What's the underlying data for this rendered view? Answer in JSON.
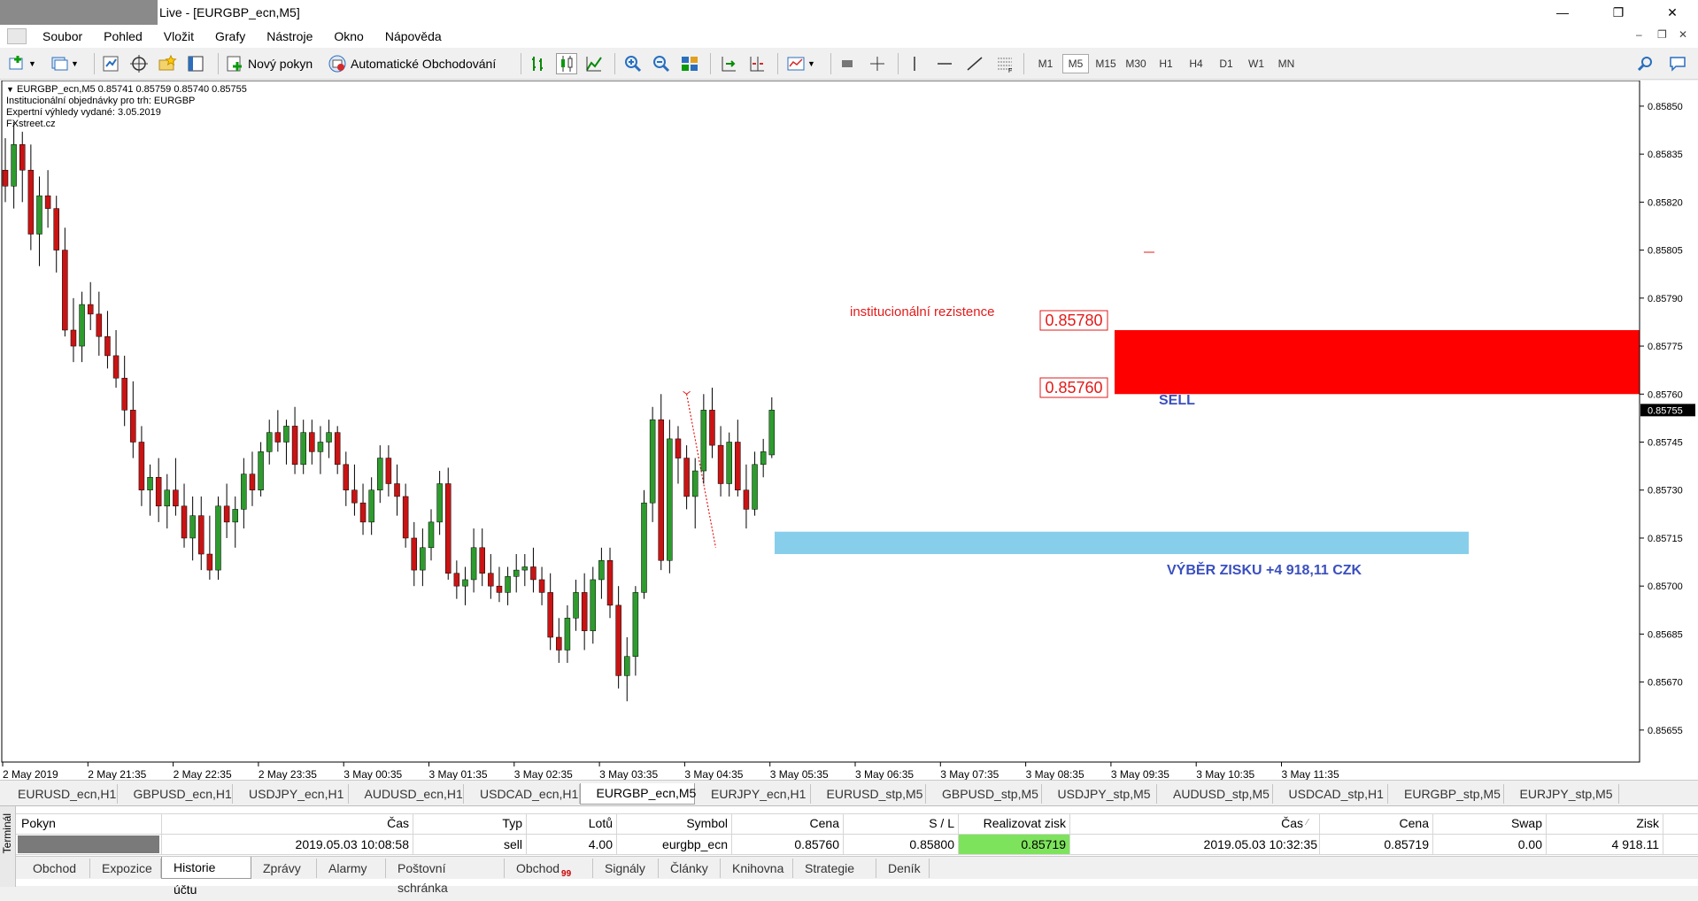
{
  "window": {
    "title": "Live - [EURGBP_ecn,M5]",
    "minimize": "—",
    "maximize": "❐",
    "close": "✕"
  },
  "menu": {
    "items": [
      "Soubor",
      "Pohled",
      "Vložit",
      "Grafy",
      "Nástroje",
      "Okno",
      "Nápověda"
    ],
    "mdi": [
      "–",
      "❐",
      "✕"
    ]
  },
  "toolbar": {
    "new_order": "Nový pokyn",
    "auto_trading": "Automatické Obchodování",
    "timeframes": [
      "M1",
      "M5",
      "M15",
      "M30",
      "H1",
      "H4",
      "D1",
      "W1",
      "MN"
    ],
    "active_timeframe": "M5"
  },
  "chart": {
    "info_lines": [
      "EURGBP_ecn,M5  0.85741 0.85759 0.85740 0.85755",
      "Institucionální objednávky pro trh: EURGBP",
      "Expertní výhledy vydané: 3.05.2019",
      "FXstreet.cz"
    ],
    "current_price": "0.85755",
    "price_ticks": [
      "0.85850",
      "0.85835",
      "0.85820",
      "0.85805",
      "0.85790",
      "0.85775",
      "0.85760",
      "0.85745",
      "0.85730",
      "0.85715",
      "0.85700",
      "0.85685",
      "0.85670",
      "0.85655"
    ],
    "time_ticks": [
      "2 May 2019",
      "2 May 21:35",
      "2 May 22:35",
      "2 May 23:35",
      "3 May 00:35",
      "3 May 01:35",
      "3 May 02:35",
      "3 May 03:35",
      "3 May 04:35",
      "3 May 05:35",
      "3 May 06:35",
      "3 May 07:35",
      "3 May 08:35",
      "3 May 09:35",
      "3 May 10:35",
      "3 May 11:35"
    ],
    "resistance_label": "institucionální rezistence",
    "resistance_upper": "0.85780",
    "resistance_lower": "0.85760",
    "sell_label": "SELL",
    "profit_label": "VÝBĚR ZISKU +4 918,11 CZK",
    "colors": {
      "bull": "#2e9b2e",
      "bear": "#c81414",
      "resistance_zone": "#ff0000",
      "target_zone": "#87ceeb",
      "annotation": "#3a4fbf",
      "label_red": "#e31b1b"
    },
    "chart_data": {
      "type": "candlestick",
      "symbol": "EURGBP_ecn",
      "timeframe": "M5",
      "last": {
        "open": 0.85741,
        "high": 0.85759,
        "low": 0.8574,
        "close": 0.85755
      },
      "ylim": [
        0.85645,
        0.85858
      ],
      "resistance_zone": [
        0.8576,
        0.8578
      ],
      "target_zone": [
        0.8571,
        0.85717
      ],
      "candles": [
        [
          0.8583,
          0.8584,
          0.8582,
          0.85825
        ],
        [
          0.85825,
          0.85845,
          0.85818,
          0.85838
        ],
        [
          0.85838,
          0.85842,
          0.8582,
          0.8583
        ],
        [
          0.8583,
          0.85838,
          0.85805,
          0.8581
        ],
        [
          0.8581,
          0.85828,
          0.858,
          0.85822
        ],
        [
          0.85822,
          0.8583,
          0.85812,
          0.85818
        ],
        [
          0.85818,
          0.85822,
          0.85798,
          0.85805
        ],
        [
          0.85805,
          0.85812,
          0.85778,
          0.8578
        ],
        [
          0.8578,
          0.8579,
          0.8577,
          0.85775
        ],
        [
          0.85775,
          0.85792,
          0.8577,
          0.85788
        ],
        [
          0.85788,
          0.85795,
          0.8578,
          0.85785
        ],
        [
          0.85785,
          0.85792,
          0.85772,
          0.85778
        ],
        [
          0.85778,
          0.85786,
          0.85768,
          0.85772
        ],
        [
          0.85772,
          0.8578,
          0.85762,
          0.85765
        ],
        [
          0.85765,
          0.85772,
          0.8575,
          0.85755
        ],
        [
          0.85755,
          0.85764,
          0.8574,
          0.85745
        ],
        [
          0.85745,
          0.8575,
          0.85725,
          0.8573
        ],
        [
          0.8573,
          0.85738,
          0.85722,
          0.85734
        ],
        [
          0.85734,
          0.8574,
          0.8572,
          0.85725
        ],
        [
          0.85725,
          0.85735,
          0.85718,
          0.8573
        ],
        [
          0.8573,
          0.8574,
          0.85722,
          0.85725
        ],
        [
          0.85725,
          0.85732,
          0.85712,
          0.85715
        ],
        [
          0.85715,
          0.85728,
          0.85708,
          0.85722
        ],
        [
          0.85722,
          0.85728,
          0.85705,
          0.8571
        ],
        [
          0.8571,
          0.85722,
          0.85702,
          0.85705
        ],
        [
          0.85705,
          0.85728,
          0.85702,
          0.85725
        ],
        [
          0.85725,
          0.85732,
          0.85715,
          0.8572
        ],
        [
          0.8572,
          0.85728,
          0.85712,
          0.85724
        ],
        [
          0.85724,
          0.8574,
          0.85718,
          0.85735
        ],
        [
          0.85735,
          0.85742,
          0.85725,
          0.8573
        ],
        [
          0.8573,
          0.85745,
          0.85728,
          0.85742
        ],
        [
          0.85742,
          0.85752,
          0.85738,
          0.85748
        ],
        [
          0.85748,
          0.85755,
          0.85742,
          0.85745
        ],
        [
          0.85745,
          0.85752,
          0.85738,
          0.8575
        ],
        [
          0.8575,
          0.85756,
          0.85735,
          0.85738
        ],
        [
          0.85738,
          0.85752,
          0.85735,
          0.85748
        ],
        [
          0.85748,
          0.85752,
          0.85738,
          0.85742
        ],
        [
          0.85742,
          0.8575,
          0.85735,
          0.85745
        ],
        [
          0.85745,
          0.85752,
          0.8574,
          0.85748
        ],
        [
          0.85748,
          0.8575,
          0.85735,
          0.85738
        ],
        [
          0.85738,
          0.85742,
          0.85725,
          0.8573
        ],
        [
          0.8573,
          0.85738,
          0.85722,
          0.85726
        ],
        [
          0.85726,
          0.85732,
          0.85716,
          0.8572
        ],
        [
          0.8572,
          0.85734,
          0.85716,
          0.8573
        ],
        [
          0.8573,
          0.85744,
          0.85726,
          0.8574
        ],
        [
          0.8574,
          0.85744,
          0.85728,
          0.85732
        ],
        [
          0.85732,
          0.85738,
          0.85722,
          0.85728
        ],
        [
          0.85728,
          0.85732,
          0.85712,
          0.85715
        ],
        [
          0.85715,
          0.8572,
          0.857,
          0.85705
        ],
        [
          0.85705,
          0.85718,
          0.857,
          0.85712
        ],
        [
          0.85712,
          0.85724,
          0.85708,
          0.8572
        ],
        [
          0.8572,
          0.85736,
          0.85716,
          0.85732
        ],
        [
          0.85732,
          0.85737,
          0.85702,
          0.85704
        ],
        [
          0.85704,
          0.85708,
          0.85696,
          0.857
        ],
        [
          0.857,
          0.85706,
          0.85694,
          0.85702
        ],
        [
          0.85702,
          0.85718,
          0.85698,
          0.85712
        ],
        [
          0.85712,
          0.85718,
          0.857,
          0.85704
        ],
        [
          0.85704,
          0.8571,
          0.85696,
          0.857
        ],
        [
          0.857,
          0.85706,
          0.85695,
          0.85698
        ],
        [
          0.85698,
          0.85706,
          0.85694,
          0.85703
        ],
        [
          0.85703,
          0.8571,
          0.85698,
          0.85705
        ],
        [
          0.85705,
          0.8571,
          0.857,
          0.85706
        ],
        [
          0.85706,
          0.85712,
          0.85698,
          0.85702
        ],
        [
          0.85702,
          0.85706,
          0.85694,
          0.85698
        ],
        [
          0.85698,
          0.85704,
          0.8568,
          0.85684
        ],
        [
          0.85684,
          0.8569,
          0.85676,
          0.8568
        ],
        [
          0.8568,
          0.85694,
          0.85676,
          0.8569
        ],
        [
          0.8569,
          0.85702,
          0.85686,
          0.85698
        ],
        [
          0.85698,
          0.85704,
          0.8568,
          0.85686
        ],
        [
          0.85686,
          0.85706,
          0.85682,
          0.85702
        ],
        [
          0.85702,
          0.85712,
          0.85696,
          0.85708
        ],
        [
          0.85708,
          0.85712,
          0.8569,
          0.85694
        ],
        [
          0.85694,
          0.857,
          0.85668,
          0.85672
        ],
        [
          0.85672,
          0.85684,
          0.85664,
          0.85678
        ],
        [
          0.85678,
          0.857,
          0.85672,
          0.85698
        ],
        [
          0.85698,
          0.8573,
          0.85696,
          0.85726
        ],
        [
          0.85726,
          0.85756,
          0.8572,
          0.85752
        ],
        [
          0.85752,
          0.8576,
          0.85705,
          0.85708
        ],
        [
          0.85708,
          0.85752,
          0.85704,
          0.85746
        ],
        [
          0.85746,
          0.8575,
          0.85732,
          0.8574
        ],
        [
          0.8574,
          0.85744,
          0.85724,
          0.85728
        ],
        [
          0.85728,
          0.8574,
          0.85718,
          0.85736
        ],
        [
          0.85736,
          0.8576,
          0.85732,
          0.85755
        ],
        [
          0.85755,
          0.85762,
          0.8574,
          0.85744
        ],
        [
          0.85744,
          0.8575,
          0.85728,
          0.85732
        ],
        [
          0.85732,
          0.85748,
          0.85728,
          0.85745
        ],
        [
          0.85745,
          0.85752,
          0.85728,
          0.8573
        ],
        [
          0.8573,
          0.85738,
          0.85718,
          0.85724
        ],
        [
          0.85724,
          0.85742,
          0.85722,
          0.85738
        ],
        [
          0.85738,
          0.85746,
          0.85734,
          0.85742
        ],
        [
          0.85741,
          0.85759,
          0.8574,
          0.85755
        ]
      ]
    }
  },
  "chart_tabs": [
    "EURUSD_ecn,H1",
    "GBPUSD_ecn,H1",
    "USDJPY_ecn,H1",
    "AUDUSD_ecn,H1",
    "USDCAD_ecn,H1",
    "EURGBP_ecn,M5",
    "EURJPY_ecn,H1",
    "EURUSD_stp,M5",
    "GBPUSD_stp,M5",
    "USDJPY_stp,M5",
    "AUDUSD_stp,M5",
    "USDCAD_stp,H1",
    "EURGBP_stp,M5",
    "EURJPY_stp,M5"
  ],
  "active_chart_tab": 5,
  "terminal": {
    "side_label": "Terminál",
    "headers": {
      "order": "Pokyn",
      "open_time": "Čas",
      "type": "Typ",
      "lots": "Lotů",
      "symbol": "Symbol",
      "price": "Cena",
      "sl": "S / L",
      "tp": "Realizovat zisk",
      "close_time": "Čas",
      "close_price": "Cena",
      "swap": "Swap",
      "profit": "Zisk"
    },
    "row": {
      "open_time": "2019.05.03 10:08:58",
      "type": "sell",
      "lots": "4.00",
      "symbol": "eurgbp_ecn",
      "price": "0.85760",
      "sl": "0.85800",
      "tp": "0.85719",
      "close_time": "2019.05.03 10:32:35",
      "close_price": "0.85719",
      "swap": "0.00",
      "profit": "4 918.11"
    },
    "tabs": [
      "Obchod",
      "Expozice",
      "Historie účtu",
      "Zprávy",
      "Alarmy",
      "Poštovní schránka",
      "Obchod",
      "Signály",
      "Články",
      "Knihovna",
      "Strategie",
      "Deník"
    ],
    "active_tab": 2,
    "badge": "99"
  }
}
